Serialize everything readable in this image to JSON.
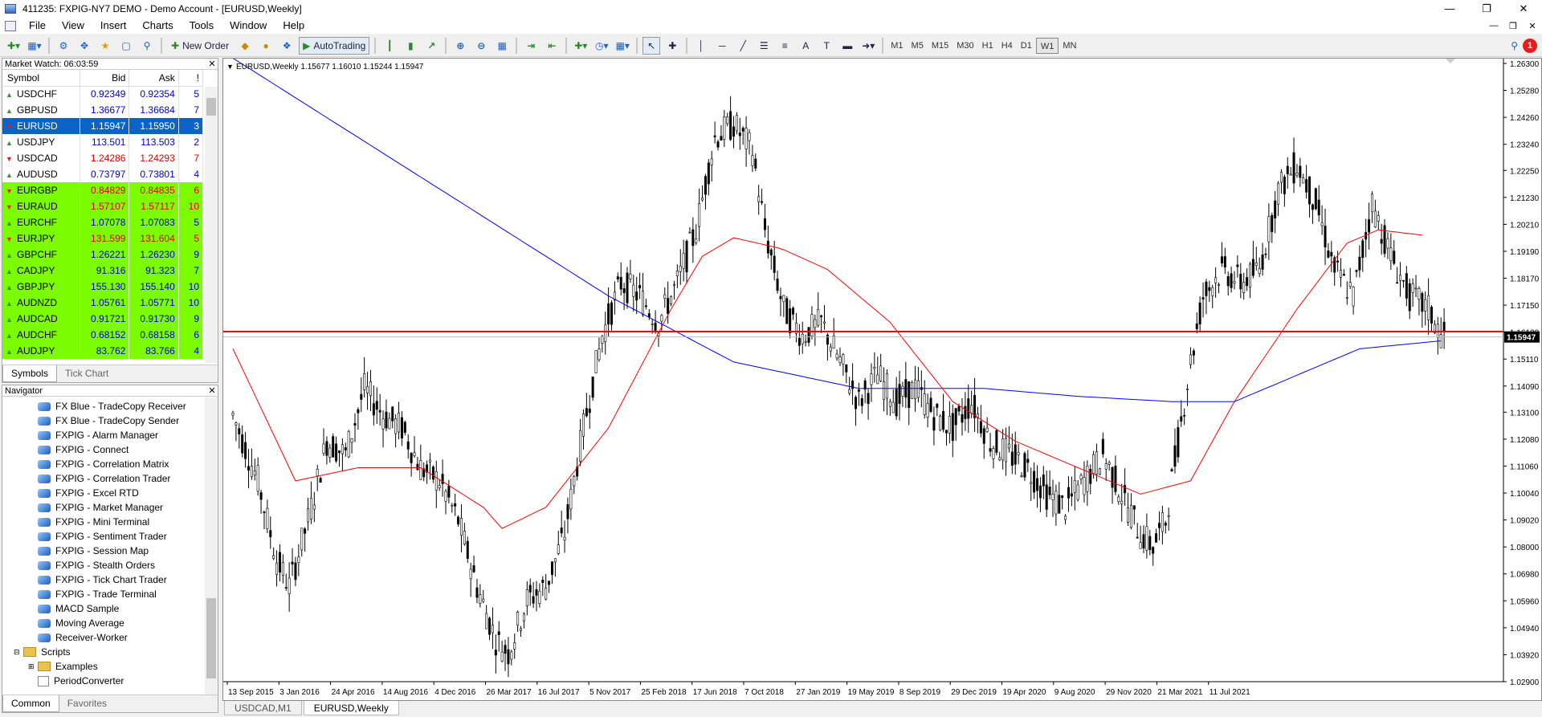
{
  "window": {
    "title": "411235: FXPIG-NY7 DEMO - Demo Account - [EURUSD,Weekly]",
    "min": "—",
    "max": "❐",
    "close": "✕"
  },
  "menu": [
    "File",
    "View",
    "Insert",
    "Charts",
    "Tools",
    "Window",
    "Help"
  ],
  "toolbar": {
    "new_order": "New Order",
    "autotrading": "AutoTrading",
    "timeframes": [
      "M1",
      "M5",
      "M15",
      "M30",
      "H1",
      "H4",
      "D1",
      "W1",
      "MN"
    ],
    "active_timeframe": "W1",
    "alert_count": "1"
  },
  "market_watch": {
    "title": "Market Watch: 06:03:59",
    "headers": {
      "symbol": "Symbol",
      "bid": "Bid",
      "ask": "Ask",
      "spread": "!"
    },
    "rows": [
      {
        "symbol": "USDCHF",
        "bid": "0.92349",
        "ask": "0.92354",
        "spread": "5",
        "dir": "up",
        "bg": "#ffffff",
        "color": "#0000cc"
      },
      {
        "symbol": "GBPUSD",
        "bid": "1.36677",
        "ask": "1.36684",
        "spread": "7",
        "dir": "up",
        "bg": "#ffffff",
        "color": "#0000cc"
      },
      {
        "symbol": "EURUSD",
        "bid": "1.15947",
        "ask": "1.15950",
        "spread": "3",
        "dir": "down",
        "bg": "#0a64c8",
        "color": "#ffffff"
      },
      {
        "symbol": "USDJPY",
        "bid": "113.501",
        "ask": "113.503",
        "spread": "2",
        "dir": "up",
        "bg": "#ffffff",
        "color": "#0000cc"
      },
      {
        "symbol": "USDCAD",
        "bid": "1.24286",
        "ask": "1.24293",
        "spread": "7",
        "dir": "down",
        "bg": "#ffffff",
        "color": "#e00000"
      },
      {
        "symbol": "AUDUSD",
        "bid": "0.73797",
        "ask": "0.73801",
        "spread": "4",
        "dir": "up",
        "bg": "#ffffff",
        "color": "#0000cc"
      },
      {
        "symbol": "EURGBP",
        "bid": "0.84829",
        "ask": "0.84835",
        "spread": "6",
        "dir": "down",
        "bg": "#7cfc00",
        "color": "#e00000"
      },
      {
        "symbol": "EURAUD",
        "bid": "1.57107",
        "ask": "1.57117",
        "spread": "10",
        "dir": "down",
        "bg": "#7cfc00",
        "color": "#e00000"
      },
      {
        "symbol": "EURCHF",
        "bid": "1.07078",
        "ask": "1.07083",
        "spread": "5",
        "dir": "up",
        "bg": "#7cfc00",
        "color": "#0000cc"
      },
      {
        "symbol": "EURJPY",
        "bid": "131.599",
        "ask": "131.604",
        "spread": "5",
        "dir": "down",
        "bg": "#7cfc00",
        "color": "#e00000"
      },
      {
        "symbol": "GBPCHF",
        "bid": "1.26221",
        "ask": "1.26230",
        "spread": "9",
        "dir": "up",
        "bg": "#7cfc00",
        "color": "#0000cc"
      },
      {
        "symbol": "CADJPY",
        "bid": "91.316",
        "ask": "91.323",
        "spread": "7",
        "dir": "up",
        "bg": "#7cfc00",
        "color": "#0000cc"
      },
      {
        "symbol": "GBPJPY",
        "bid": "155.130",
        "ask": "155.140",
        "spread": "10",
        "dir": "up",
        "bg": "#7cfc00",
        "color": "#0000cc"
      },
      {
        "symbol": "AUDNZD",
        "bid": "1.05761",
        "ask": "1.05771",
        "spread": "10",
        "dir": "up",
        "bg": "#7cfc00",
        "color": "#0000cc"
      },
      {
        "symbol": "AUDCAD",
        "bid": "0.91721",
        "ask": "0.91730",
        "spread": "9",
        "dir": "up",
        "bg": "#7cfc00",
        "color": "#0000cc"
      },
      {
        "symbol": "AUDCHF",
        "bid": "0.68152",
        "ask": "0.68158",
        "spread": "6",
        "dir": "up",
        "bg": "#7cfc00",
        "color": "#0000cc"
      },
      {
        "symbol": "AUDJPY",
        "bid": "83.762",
        "ask": "83.766",
        "spread": "4",
        "dir": "up",
        "bg": "#7cfc00",
        "color": "#0000cc"
      }
    ],
    "tabs": [
      "Symbols",
      "Tick Chart"
    ]
  },
  "navigator": {
    "title": "Navigator",
    "items": [
      {
        "label": "FX Blue - TradeCopy Receiver",
        "type": "ea"
      },
      {
        "label": "FX Blue - TradeCopy Sender",
        "type": "ea"
      },
      {
        "label": "FXPIG - Alarm Manager",
        "type": "ea"
      },
      {
        "label": "FXPIG - Connect",
        "type": "ea"
      },
      {
        "label": "FXPIG - Correlation Matrix",
        "type": "ea"
      },
      {
        "label": "FXPIG - Correlation Trader",
        "type": "ea"
      },
      {
        "label": "FXPIG - Excel RTD",
        "type": "ea"
      },
      {
        "label": "FXPIG - Market Manager",
        "type": "ea"
      },
      {
        "label": "FXPIG - Mini Terminal",
        "type": "ea"
      },
      {
        "label": "FXPIG - Sentiment Trader",
        "type": "ea"
      },
      {
        "label": "FXPIG - Session Map",
        "type": "ea"
      },
      {
        "label": "FXPIG - Stealth Orders",
        "type": "ea"
      },
      {
        "label": "FXPIG - Tick Chart Trader",
        "type": "ea"
      },
      {
        "label": "FXPIG - Trade Terminal",
        "type": "ea"
      },
      {
        "label": "MACD Sample",
        "type": "ea"
      },
      {
        "label": "Moving Average",
        "type": "ea"
      },
      {
        "label": "Receiver-Worker",
        "type": "ea"
      },
      {
        "label": "Scripts",
        "type": "folder"
      },
      {
        "label": "Examples",
        "type": "folder2"
      },
      {
        "label": "PeriodConverter",
        "type": "script"
      }
    ],
    "tabs": [
      "Common",
      "Favorites"
    ]
  },
  "chart_tabs": [
    "USDCAD,M1",
    "EURUSD,Weekly"
  ],
  "chart_data": {
    "type": "candlestick",
    "symbol_header": "EURUSD,Weekly  1.15677 1.16010 1.15244 1.15947",
    "y_ticks": [
      "1.26300",
      "1.25280",
      "1.24260",
      "1.23240",
      "1.22250",
      "1.21230",
      "1.20210",
      "1.19190",
      "1.18170",
      "1.17150",
      "1.16130",
      "1.15110",
      "1.14090",
      "1.13100",
      "1.12080",
      "1.11060",
      "1.10040",
      "1.09020",
      "1.08000",
      "1.06980",
      "1.05960",
      "1.04940",
      "1.03920",
      "1.02900"
    ],
    "ylim": [
      1.029,
      1.263
    ],
    "x_ticks": [
      "13 Sep 2015",
      "3 Jan 2016",
      "24 Apr 2016",
      "14 Aug 2016",
      "4 Dec 2016",
      "26 Mar 2017",
      "16 Jul 2017",
      "5 Nov 2017",
      "25 Feb 2018",
      "17 Jun 2018",
      "7 Oct 2018",
      "27 Jan 2019",
      "19 May 2019",
      "8 Sep 2019",
      "29 Dec 2019",
      "19 Apr 2020",
      "9 Aug 2020",
      "29 Nov 2020",
      "21 Mar 2021",
      "11 Jul 2021"
    ],
    "current_price": "1.15947",
    "horizontal_line": 1.1615,
    "price_path": [
      [
        0,
        1.13
      ],
      [
        8,
        1.105
      ],
      [
        14,
        1.075
      ],
      [
        18,
        1.065
      ],
      [
        24,
        1.09
      ],
      [
        30,
        1.12
      ],
      [
        36,
        1.115
      ],
      [
        42,
        1.14
      ],
      [
        48,
        1.13
      ],
      [
        54,
        1.125
      ],
      [
        60,
        1.11
      ],
      [
        66,
        1.105
      ],
      [
        72,
        1.09
      ],
      [
        78,
        1.065
      ],
      [
        84,
        1.045
      ],
      [
        88,
        1.04
      ],
      [
        94,
        1.06
      ],
      [
        100,
        1.065
      ],
      [
        106,
        1.085
      ],
      [
        112,
        1.125
      ],
      [
        118,
        1.16
      ],
      [
        124,
        1.18
      ],
      [
        130,
        1.175
      ],
      [
        136,
        1.165
      ],
      [
        142,
        1.18
      ],
      [
        148,
        1.2
      ],
      [
        154,
        1.235
      ],
      [
        160,
        1.24
      ],
      [
        166,
        1.23
      ],
      [
        170,
        1.2
      ],
      [
        176,
        1.17
      ],
      [
        182,
        1.16
      ],
      [
        188,
        1.165
      ],
      [
        194,
        1.15
      ],
      [
        200,
        1.135
      ],
      [
        206,
        1.145
      ],
      [
        212,
        1.135
      ],
      [
        218,
        1.14
      ],
      [
        224,
        1.13
      ],
      [
        230,
        1.125
      ],
      [
        236,
        1.135
      ],
      [
        242,
        1.12
      ],
      [
        248,
        1.115
      ],
      [
        254,
        1.11
      ],
      [
        260,
        1.1
      ],
      [
        266,
        1.095
      ],
      [
        272,
        1.105
      ],
      [
        278,
        1.115
      ],
      [
        284,
        1.1
      ],
      [
        290,
        1.085
      ],
      [
        294,
        1.08
      ],
      [
        298,
        1.09
      ],
      [
        302,
        1.12
      ],
      [
        306,
        1.15
      ],
      [
        310,
        1.175
      ],
      [
        316,
        1.185
      ],
      [
        322,
        1.18
      ],
      [
        328,
        1.185
      ],
      [
        334,
        1.215
      ],
      [
        340,
        1.225
      ],
      [
        346,
        1.21
      ],
      [
        352,
        1.185
      ],
      [
        358,
        1.175
      ],
      [
        364,
        1.21
      ],
      [
        370,
        1.19
      ],
      [
        376,
        1.175
      ],
      [
        382,
        1.17
      ],
      [
        386,
        1.16
      ]
    ],
    "ma_slow": [
      [
        0,
        1.265
      ],
      [
        40,
        1.235
      ],
      [
        80,
        1.205
      ],
      [
        120,
        1.175
      ],
      [
        160,
        1.15
      ],
      [
        200,
        1.14
      ],
      [
        240,
        1.14
      ],
      [
        270,
        1.137
      ],
      [
        300,
        1.135
      ],
      [
        320,
        1.135
      ],
      [
        340,
        1.145
      ],
      [
        360,
        1.155
      ],
      [
        386,
        1.158
      ]
    ],
    "ma_fast": [
      [
        0,
        1.155
      ],
      [
        10,
        1.13
      ],
      [
        20,
        1.105
      ],
      [
        40,
        1.11
      ],
      [
        60,
        1.11
      ],
      [
        80,
        1.095
      ],
      [
        86,
        1.087
      ],
      [
        100,
        1.095
      ],
      [
        120,
        1.125
      ],
      [
        140,
        1.17
      ],
      [
        150,
        1.19
      ],
      [
        160,
        1.197
      ],
      [
        175,
        1.193
      ],
      [
        190,
        1.185
      ],
      [
        210,
        1.165
      ],
      [
        230,
        1.135
      ],
      [
        250,
        1.12
      ],
      [
        270,
        1.11
      ],
      [
        290,
        1.1
      ],
      [
        306,
        1.105
      ],
      [
        320,
        1.135
      ],
      [
        340,
        1.17
      ],
      [
        356,
        1.195
      ],
      [
        366,
        1.2
      ],
      [
        380,
        1.198
      ]
    ]
  },
  "colors": {
    "ma_slow": "#0000ff",
    "ma_fast": "#ff0000",
    "hline": "#ff0000",
    "candle": "#000000",
    "price_label_bg": "#000000"
  }
}
